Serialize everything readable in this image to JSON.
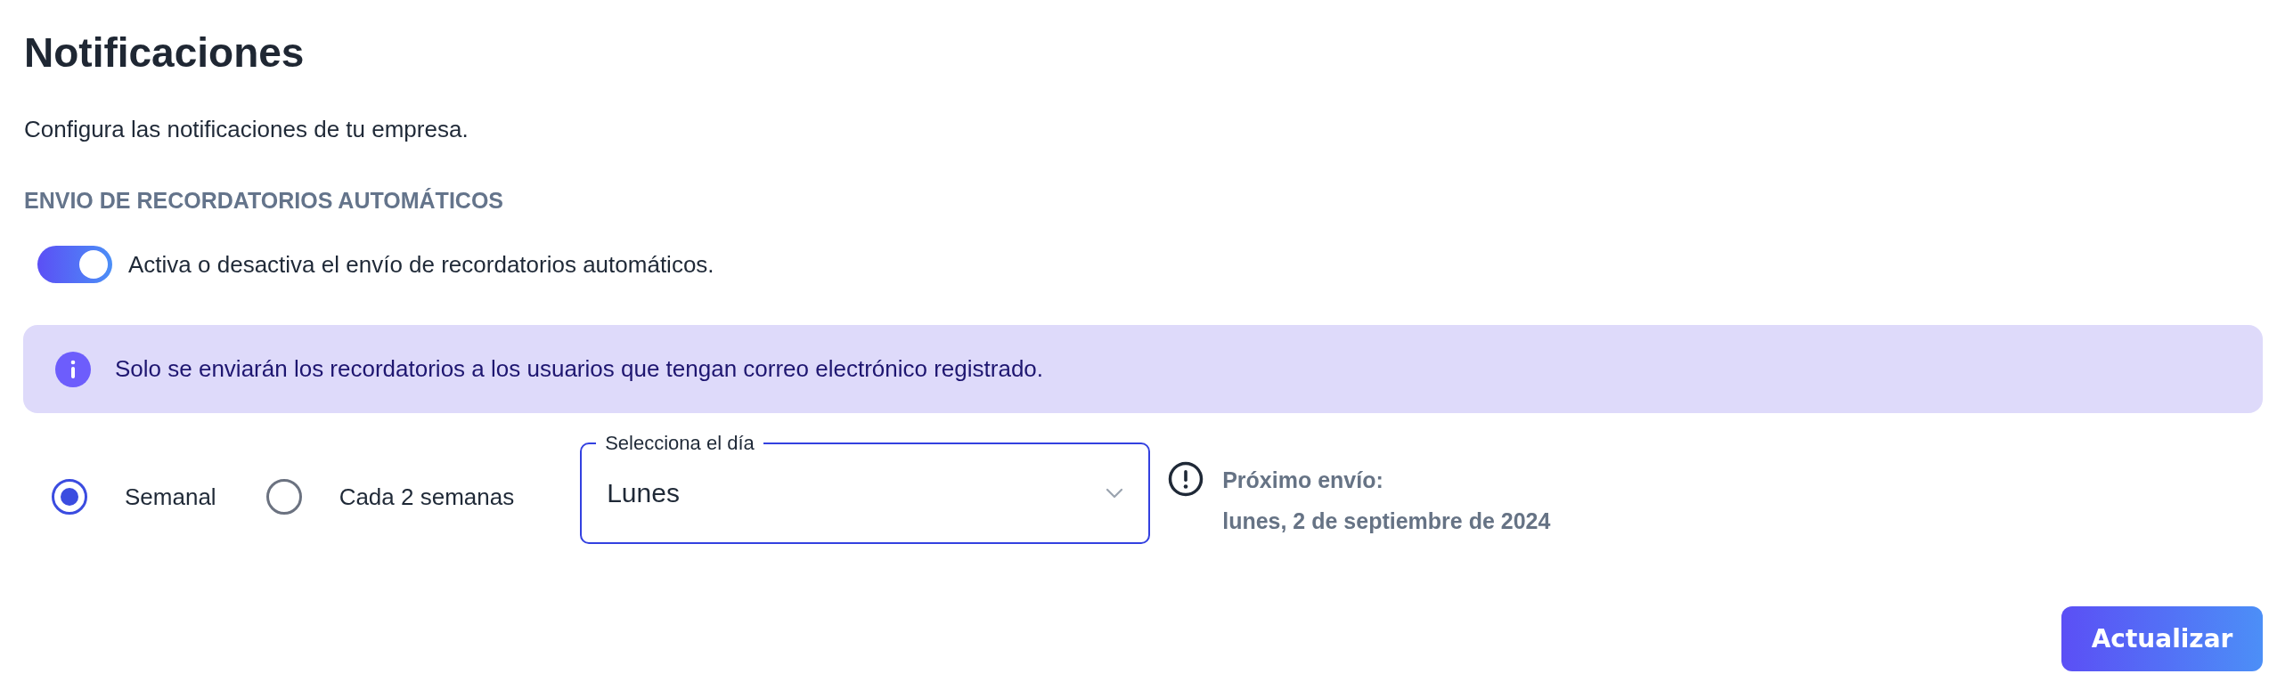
{
  "page": {
    "title": "Notificaciones",
    "subtitle": "Configura las notificaciones de tu empresa."
  },
  "section": {
    "heading": "ENVIO DE RECORDATORIOS AUTOMÁTICOS"
  },
  "toggle": {
    "label": "Activa o desactiva el envío de recordatorios automáticos.",
    "on": true
  },
  "info_banner": {
    "text": "Solo se enviarán los recordatorios a los usuarios que tengan correo electrónico registrado."
  },
  "frequency": [
    {
      "label": "Semanal",
      "selected": true
    },
    {
      "label": "Cada 2 semanas",
      "selected": false
    }
  ],
  "day_select": {
    "label": "Selecciona el día",
    "value": "Lunes"
  },
  "next_send": {
    "label": "Próximo envío:",
    "date": "lunes, 2 de septiembre de 2024"
  },
  "buttons": [
    {
      "label": "Actualizar"
    }
  ]
}
